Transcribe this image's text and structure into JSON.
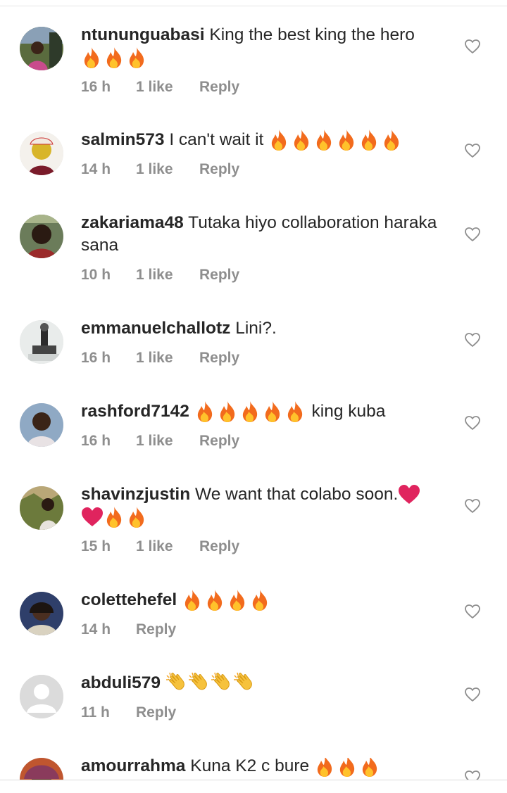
{
  "comments": [
    {
      "username": "ntununguabasi",
      "text": "King the best king the hero",
      "emoji": [
        "fire",
        "fire",
        "fire"
      ],
      "time": "16 h",
      "likes": "1 like",
      "reply": "Reply"
    },
    {
      "username": "salmin573",
      "text": "I can't wait it",
      "emoji": [
        "fire",
        "fire",
        "fire",
        "fire",
        "fire",
        "fire"
      ],
      "time": "14 h",
      "likes": "1 like",
      "reply": "Reply"
    },
    {
      "username": "zakariama48",
      "text": "Tutaka hiyo collaboration haraka sana",
      "emoji": [],
      "time": "10 h",
      "likes": "1 like",
      "reply": "Reply"
    },
    {
      "username": "emmanuelchallotz",
      "text": "Lini?.",
      "emoji": [],
      "time": "16 h",
      "likes": "1 like",
      "reply": "Reply"
    },
    {
      "username": "rashford7142",
      "text": "king kuba",
      "emoji_before": [
        "fire",
        "fire",
        "fire",
        "fire",
        "fire"
      ],
      "time": "16 h",
      "likes": "1 like",
      "reply": "Reply"
    },
    {
      "username": "shavinzjustin",
      "text": "We want that colabo soon.",
      "emoji": [
        "red-heart",
        "red-heart",
        "fire",
        "fire"
      ],
      "time": "15 h",
      "likes": "1 like",
      "reply": "Reply"
    },
    {
      "username": "colettehefel",
      "text": "",
      "emoji": [
        "fire",
        "fire",
        "fire",
        "fire"
      ],
      "time": "14 h",
      "likes": "",
      "reply": "Reply"
    },
    {
      "username": "abduli579",
      "text": "",
      "emoji": [
        "clap",
        "clap",
        "clap",
        "clap"
      ],
      "time": "11 h",
      "likes": "",
      "reply": "Reply"
    },
    {
      "username": "amourrahma",
      "text": "Kuna K2 c bure",
      "emoji": [
        "fire",
        "fire",
        "fire"
      ],
      "time": "",
      "likes": "",
      "reply": ""
    }
  ],
  "icons": {
    "like": "heart-outline-icon",
    "fire": "fire-emoji",
    "clap": "clapping-hands-emoji",
    "love": "red-heart-emoji"
  },
  "colors": {
    "text": "#262626",
    "meta": "#8e8e8e",
    "heart_outline": "#8e8e8e",
    "red_heart": "#e0245e"
  }
}
